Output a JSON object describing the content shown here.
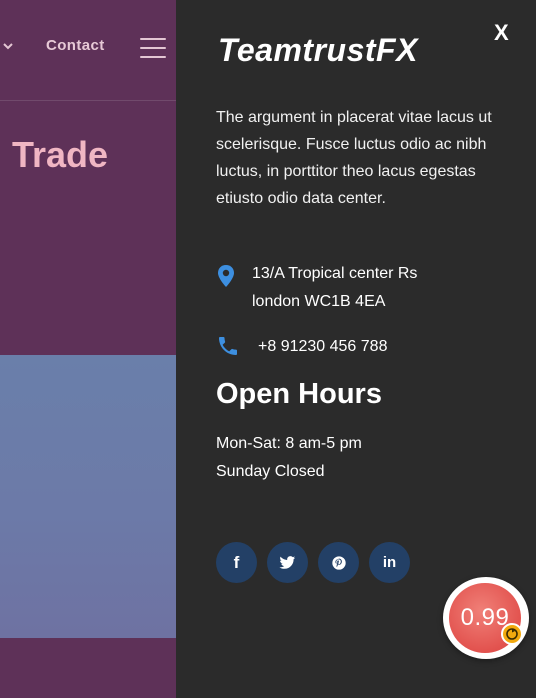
{
  "background_site": {
    "nav_contact_label": "Contact",
    "hero_text": "l Trade"
  },
  "panel": {
    "close_label": "X",
    "logo_text": "TeamtrustFX",
    "about_text": "The argument in placerat vitae lacus ut scelerisque. Fusce luctus odio ac nibh luctus, in porttitor theo lacus egestas etiusto odio data center.",
    "address_line1": "13/A Tropical center Rs",
    "address_line2": "london WC1B 4EA",
    "phone": "+8 91230 456 788",
    "hours_title": "Open Hours",
    "hours_line1": "Mon-Sat: 8 am-5 pm",
    "hours_line2": "Sunday Closed",
    "social": [
      {
        "icon": "facebook-icon",
        "glyph": "f"
      },
      {
        "icon": "twitter-icon",
        "glyph": ""
      },
      {
        "icon": "pinterest-icon",
        "glyph": ""
      },
      {
        "icon": "linkedin-icon",
        "glyph": "in"
      }
    ]
  },
  "widget": {
    "value": "0.99",
    "badge_icon": "refresh-icon"
  },
  "colors": {
    "site_bg": "#5e3158",
    "panel_bg": "#2b2b2b",
    "accent_blue": "#3d8fe0",
    "social_bg": "#234066",
    "widget_red": "#e2524e",
    "hero_pink": "#f0b6c3"
  }
}
